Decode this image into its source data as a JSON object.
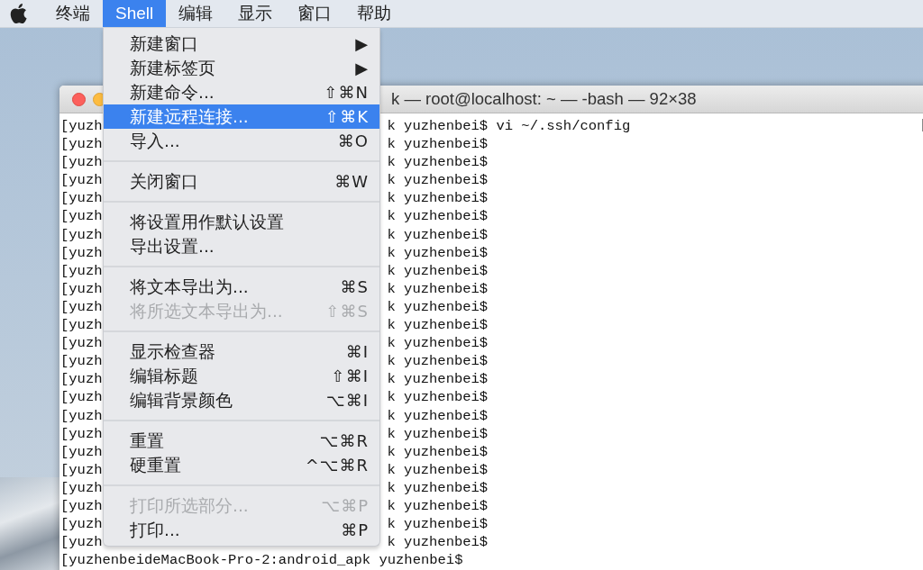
{
  "menu_bar": {
    "items": [
      {
        "label": "终端",
        "selected": false
      },
      {
        "label": "Shell",
        "selected": true
      },
      {
        "label": "编辑",
        "selected": false
      },
      {
        "label": "显示",
        "selected": false
      },
      {
        "label": "窗口",
        "selected": false
      },
      {
        "label": "帮助",
        "selected": false
      }
    ]
  },
  "shell_menu": {
    "items": [
      {
        "kind": "item",
        "label": "新建窗口",
        "shortcut": "▶",
        "selected": false,
        "disabled": false
      },
      {
        "kind": "item",
        "label": "新建标签页",
        "shortcut": "▶",
        "selected": false,
        "disabled": false
      },
      {
        "kind": "item",
        "label": "新建命令...",
        "shortcut": "⇧⌘N",
        "selected": false,
        "disabled": false
      },
      {
        "kind": "item",
        "label": "新建远程连接...",
        "shortcut": "⇧⌘K",
        "selected": true,
        "disabled": false
      },
      {
        "kind": "item",
        "label": "导入...",
        "shortcut": "⌘O",
        "selected": false,
        "disabled": false
      },
      {
        "kind": "separator"
      },
      {
        "kind": "item",
        "label": "关闭窗口",
        "shortcut": "⌘W",
        "selected": false,
        "disabled": false
      },
      {
        "kind": "separator"
      },
      {
        "kind": "item",
        "label": "将设置用作默认设置",
        "selected": false,
        "disabled": false
      },
      {
        "kind": "item",
        "label": "导出设置...",
        "selected": false,
        "disabled": false
      },
      {
        "kind": "separator"
      },
      {
        "kind": "item",
        "label": "将文本导出为...",
        "shortcut": "⌘S",
        "selected": false,
        "disabled": false
      },
      {
        "kind": "item",
        "label": "将所选文本导出为...",
        "shortcut": "⇧⌘S",
        "selected": false,
        "disabled": true
      },
      {
        "kind": "separator"
      },
      {
        "kind": "item",
        "label": "显示检查器",
        "shortcut": "⌘I",
        "selected": false,
        "disabled": false
      },
      {
        "kind": "item",
        "label": "编辑标题",
        "shortcut": "⇧⌘I",
        "selected": false,
        "disabled": false
      },
      {
        "kind": "item",
        "label": "编辑背景颜色",
        "shortcut": "⌥⌘I",
        "selected": false,
        "disabled": false
      },
      {
        "kind": "separator"
      },
      {
        "kind": "item",
        "label": "重置",
        "shortcut": "⌥⌘R",
        "selected": false,
        "disabled": false
      },
      {
        "kind": "item",
        "label": "硬重置",
        "shortcut": "^⌥⌘R",
        "selected": false,
        "disabled": false
      },
      {
        "kind": "separator"
      },
      {
        "kind": "item",
        "label": "打印所选部分...",
        "shortcut": "⌥⌘P",
        "selected": false,
        "disabled": true
      },
      {
        "kind": "item",
        "label": "打印...",
        "shortcut": "⌘P",
        "selected": false,
        "disabled": false
      }
    ]
  },
  "terminal": {
    "title": "k — root@localhost: ~ — -bash — 92×38",
    "rows": [
      {
        "kind": "split",
        "left": "[yuzh",
        "right": "k yuzhenbei$ vi ~/.ssh/config"
      },
      {
        "kind": "split",
        "left": "[yuzh",
        "right": "k yuzhenbei$"
      },
      {
        "kind": "split",
        "left": "[yuzh",
        "right": "k yuzhenbei$"
      },
      {
        "kind": "split",
        "left": "[yuzh",
        "right": "k yuzhenbei$"
      },
      {
        "kind": "split",
        "left": "[yuzh",
        "right": "k yuzhenbei$"
      },
      {
        "kind": "split",
        "left": "[yuzh",
        "right": "k yuzhenbei$"
      },
      {
        "kind": "split",
        "left": "[yuzh",
        "right": "k yuzhenbei$"
      },
      {
        "kind": "split",
        "left": "[yuzh",
        "right": "k yuzhenbei$"
      },
      {
        "kind": "split",
        "left": "[yuzh",
        "right": "k yuzhenbei$"
      },
      {
        "kind": "split",
        "left": "[yuzh",
        "right": "k yuzhenbei$"
      },
      {
        "kind": "split",
        "left": "[yuzh",
        "right": "k yuzhenbei$"
      },
      {
        "kind": "split",
        "left": "[yuzh",
        "right": "k yuzhenbei$"
      },
      {
        "kind": "split",
        "left": "[yuzh",
        "right": "k yuzhenbei$"
      },
      {
        "kind": "split",
        "left": "[yuzh",
        "right": "k yuzhenbei$"
      },
      {
        "kind": "split",
        "left": "[yuzh",
        "right": "k yuzhenbei$"
      },
      {
        "kind": "split",
        "left": "[yuzh",
        "right": "k yuzhenbei$"
      },
      {
        "kind": "split",
        "left": "[yuzh",
        "right": "k yuzhenbei$"
      },
      {
        "kind": "split",
        "left": "[yuzh",
        "right": "k yuzhenbei$"
      },
      {
        "kind": "split",
        "left": "[yuzh",
        "right": "k yuzhenbei$"
      },
      {
        "kind": "split",
        "left": "[yuzh",
        "right": "k yuzhenbei$"
      },
      {
        "kind": "split",
        "left": "[yuzh",
        "right": "k yuzhenbei$"
      },
      {
        "kind": "split",
        "left": "[yuzh",
        "right": "k yuzhenbei$"
      },
      {
        "kind": "split",
        "left": "[yuzh",
        "right": "k yuzhenbei$"
      },
      {
        "kind": "split",
        "left": "[yuzh",
        "right": "k yuzhenbei$"
      },
      {
        "kind": "full",
        "text": "[yuzhenbeideMacBook-Pro-2:android_apk yuzhenbei$"
      }
    ]
  }
}
